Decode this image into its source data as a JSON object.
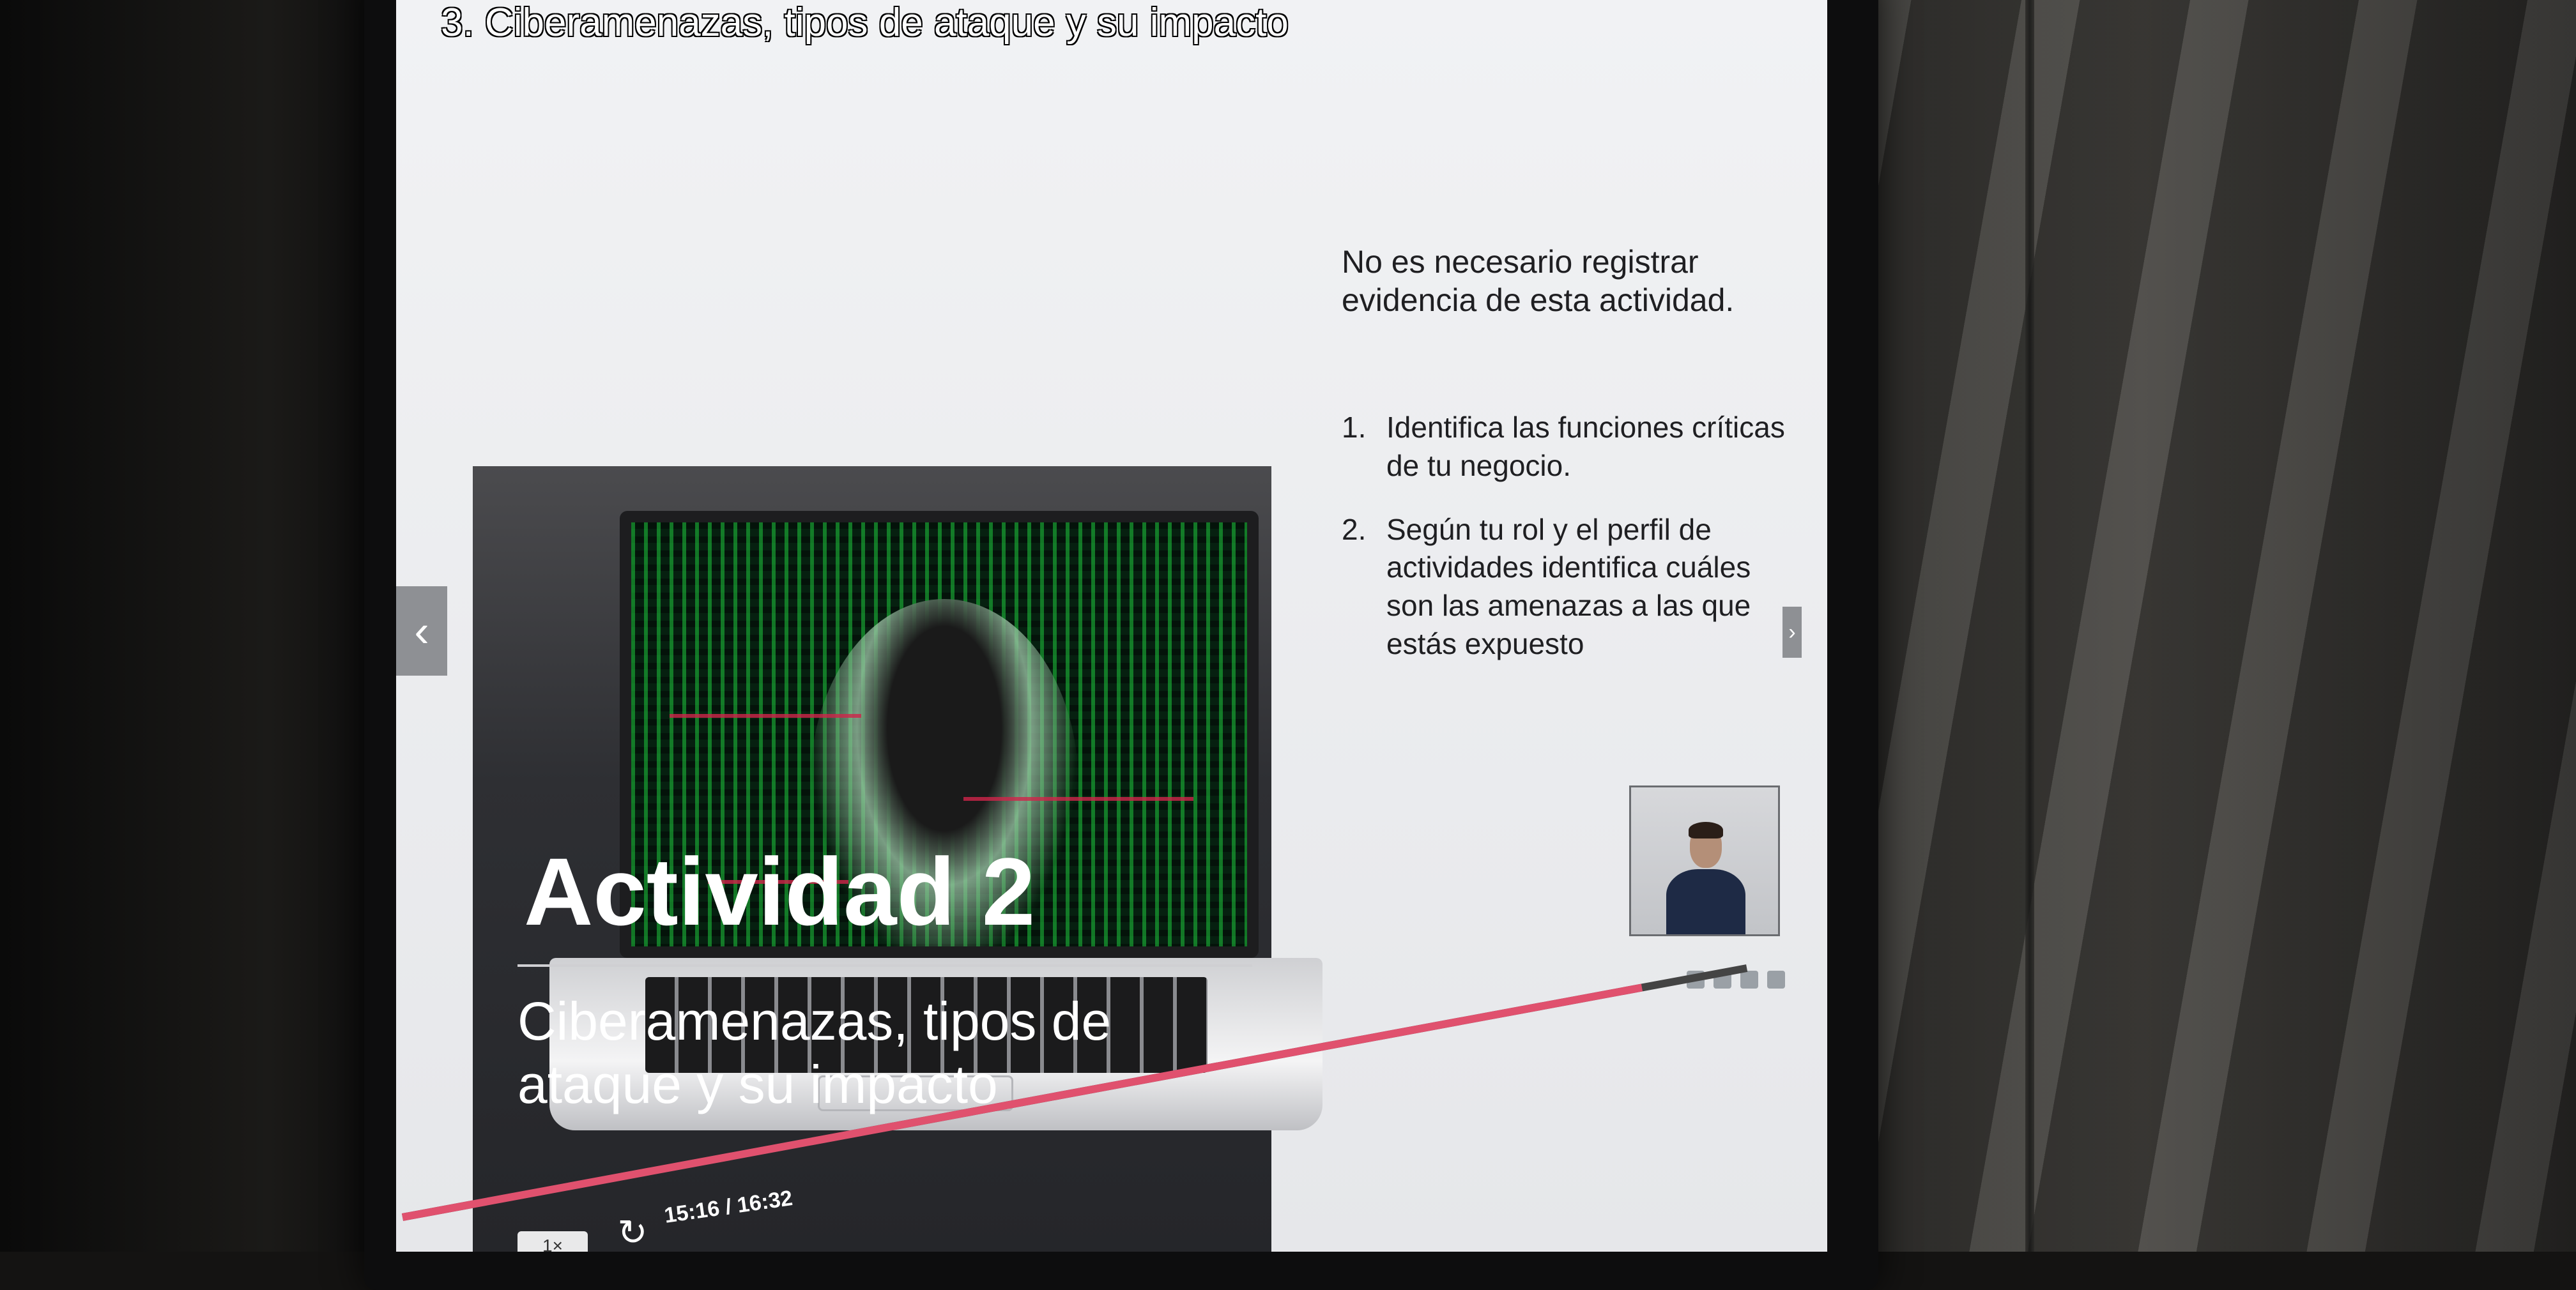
{
  "slide": {
    "title": "3. Ciberamenazas, tipos de ataque y su impacto",
    "activity_title": "Actividad 2",
    "activity_subtitle": "Ciberamenazas, tipos de ataque y su impacto",
    "note": "No es necesario registrar evidencia de esta actividad.",
    "steps": [
      {
        "number": "1.",
        "text": "Identifica las funciones críticas de tu negocio."
      },
      {
        "number": "2.",
        "text": "Según tu rol y el perfil de actividades identifica cuáles son las amenazas a las que estás expuesto"
      }
    ]
  },
  "navigation": {
    "prev_icon": "chevron-left-icon",
    "prev_glyph": "‹",
    "next_icon": "chevron-right-icon",
    "next_glyph": "›"
  },
  "player": {
    "speed": "1×",
    "replay_icon": "replay-icon",
    "replay_glyph": "↻",
    "current_time": "15:16",
    "separator": "/",
    "total_time": "16:32",
    "progress": 0.922
  },
  "colors": {
    "progress": "#e0516e",
    "panel": "#2e2f33",
    "screen_bg": "#eceef1"
  }
}
